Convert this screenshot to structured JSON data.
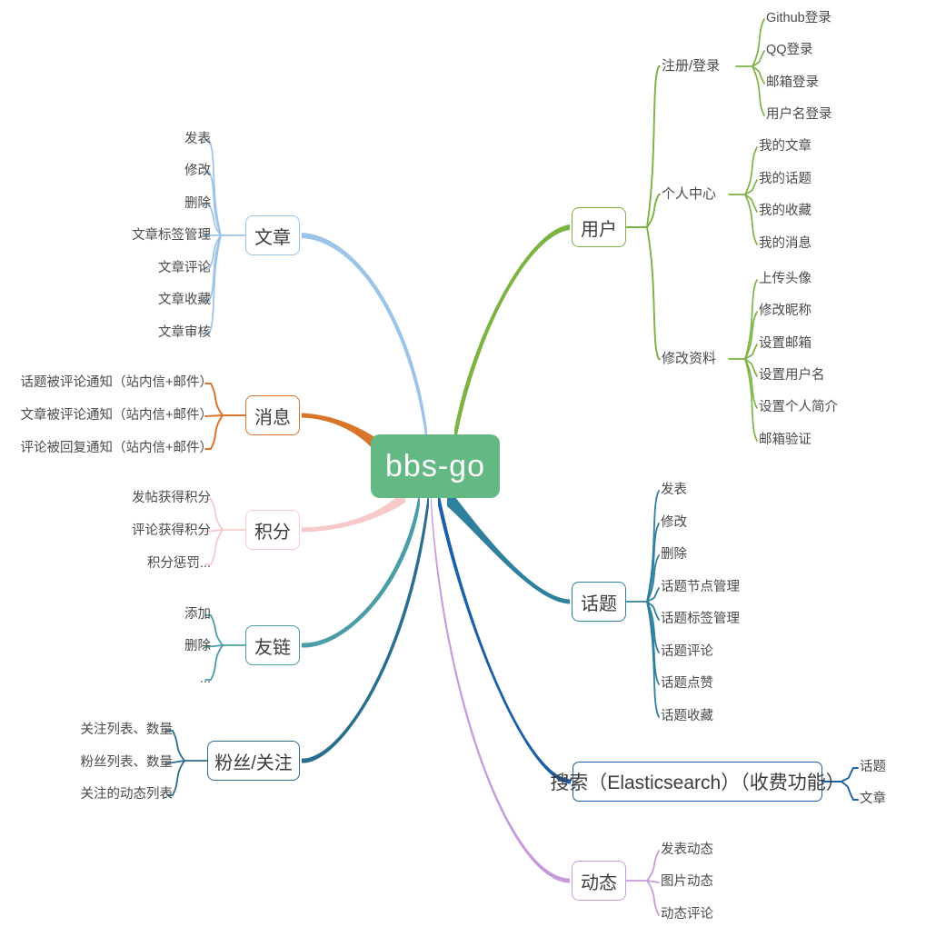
{
  "root": {
    "label": "bbs-go",
    "color": "#63b884"
  },
  "branches": [
    {
      "id": "article",
      "label": "文章",
      "color": "#9cc3e8",
      "side": "left",
      "children": [
        {
          "label": "发表"
        },
        {
          "label": "修改"
        },
        {
          "label": "删除"
        },
        {
          "label": "文章标签管理"
        },
        {
          "label": "文章评论"
        },
        {
          "label": "文章收藏"
        },
        {
          "label": "文章审核"
        }
      ]
    },
    {
      "id": "message",
      "label": "消息",
      "color": "#d9762b",
      "side": "left",
      "children": [
        {
          "label": "话题被评论通知（站内信+邮件）"
        },
        {
          "label": "文章被评论通知（站内信+邮件）"
        },
        {
          "label": "评论被回复通知（站内信+邮件）"
        }
      ]
    },
    {
      "id": "points",
      "label": "积分",
      "color": "#f7c9cb",
      "side": "left",
      "children": [
        {
          "label": "发帖获得积分"
        },
        {
          "label": "评论获得积分"
        },
        {
          "label": "积分惩罚..."
        }
      ]
    },
    {
      "id": "friendlinks",
      "label": "友链",
      "color": "#4a9ca6",
      "side": "left",
      "children": [
        {
          "label": "添加"
        },
        {
          "label": "删除"
        },
        {
          "label": "..."
        }
      ]
    },
    {
      "id": "followers",
      "label": "粉丝/关注",
      "color": "#2a6d8f",
      "side": "left",
      "children": [
        {
          "label": "关注列表、数量"
        },
        {
          "label": "粉丝列表、数量"
        },
        {
          "label": "关注的动态列表"
        }
      ]
    },
    {
      "id": "user",
      "label": "用户",
      "color": "#7cb342",
      "side": "right",
      "groups": [
        {
          "label": "注册/登录",
          "children": [
            {
              "label": "Github登录"
            },
            {
              "label": "QQ登录"
            },
            {
              "label": "邮箱登录"
            },
            {
              "label": "用户名登录"
            }
          ]
        },
        {
          "label": "个人中心",
          "children": [
            {
              "label": "我的文章"
            },
            {
              "label": "我的话题"
            },
            {
              "label": "我的收藏"
            },
            {
              "label": "我的消息"
            }
          ]
        },
        {
          "label": "修改资料",
          "children": [
            {
              "label": "上传头像"
            },
            {
              "label": "修改昵称"
            },
            {
              "label": "设置邮箱"
            },
            {
              "label": "设置用户名"
            },
            {
              "label": "设置个人简介"
            },
            {
              "label": "邮箱验证"
            }
          ]
        }
      ]
    },
    {
      "id": "topic",
      "label": "话题",
      "color": "#2f7f9e",
      "side": "right",
      "children": [
        {
          "label": "发表"
        },
        {
          "label": "修改"
        },
        {
          "label": "删除"
        },
        {
          "label": "话题节点管理"
        },
        {
          "label": "话题标签管理"
        },
        {
          "label": "话题评论"
        },
        {
          "label": "话题点赞"
        },
        {
          "label": "话题收藏"
        }
      ]
    },
    {
      "id": "search",
      "label": "搜索（Elasticsearch）（收费功能）",
      "color": "#1b5fa8",
      "side": "right",
      "wide": true,
      "children": [
        {
          "label": "话题"
        },
        {
          "label": "文章"
        }
      ]
    },
    {
      "id": "feed",
      "label": "动态",
      "color": "#c79bdb",
      "side": "right",
      "children": [
        {
          "label": "发表动态"
        },
        {
          "label": "图片动态"
        },
        {
          "label": "动态评论"
        }
      ]
    }
  ]
}
